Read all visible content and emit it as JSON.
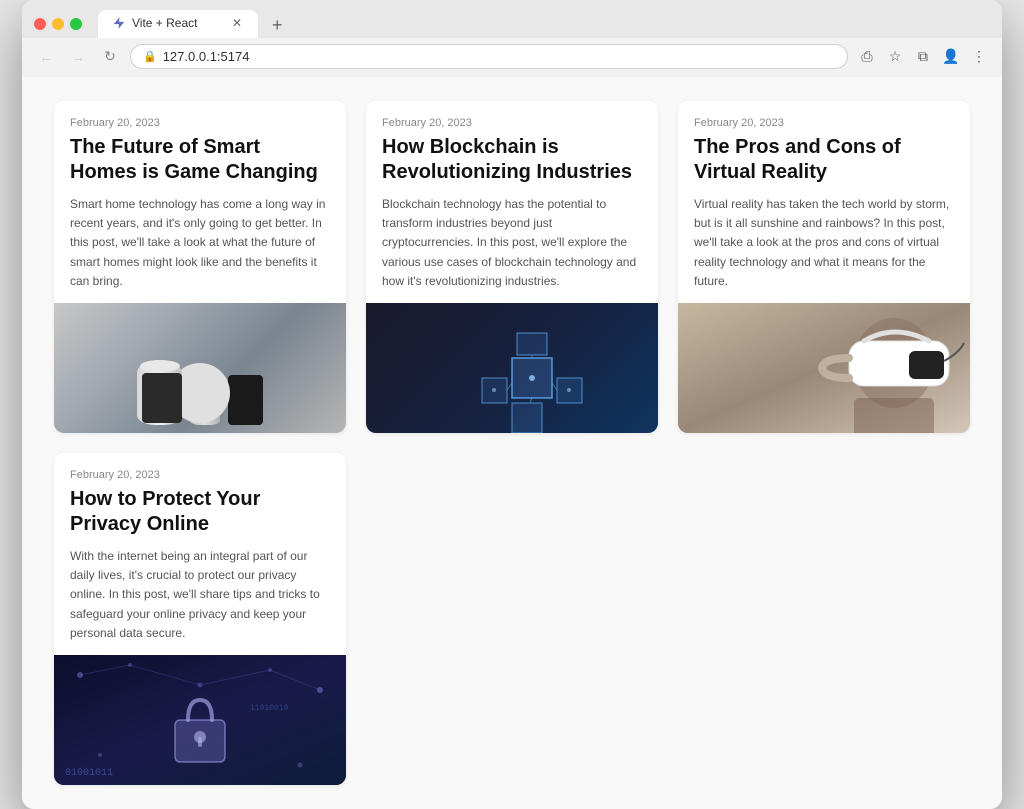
{
  "browser": {
    "tab_label": "Vite + React",
    "address": "127.0.0.1:5174",
    "address_display": "127.0.0.1:5174"
  },
  "cards": [
    {
      "id": "smart-homes",
      "date": "February 20, 2023",
      "title": "The Future of Smart Homes is Game Changing",
      "description": "Smart home technology has come a long way in recent years, and it's only going to get better. In this post, we'll take a look at what the future of smart homes might look like and the benefits it can bring.",
      "image_type": "smart-home"
    },
    {
      "id": "blockchain",
      "date": "February 20, 2023",
      "title": "How Blockchain is Revolutionizing Industries",
      "description": "Blockchain technology has the potential to transform industries beyond just cryptocurrencies. In this post, we'll explore the various use cases of blockchain technology and how it's revolutionizing industries.",
      "image_type": "blockchain"
    },
    {
      "id": "vr",
      "date": "February 20, 2023",
      "title": "The Pros and Cons of Virtual Reality",
      "description": "Virtual reality has taken the tech world by storm, but is it all sunshine and rainbows? In this post, we'll take a look at the pros and cons of virtual reality technology and what it means for the future.",
      "image_type": "vr"
    },
    {
      "id": "privacy",
      "date": "February 20, 2023",
      "title": "How to Protect Your Privacy Online",
      "description": "With the internet being an integral part of our daily lives, it's crucial to protect our privacy online. In this post, we'll share tips and tricks to safeguard your online privacy and keep your personal data secure.",
      "image_type": "privacy"
    }
  ]
}
